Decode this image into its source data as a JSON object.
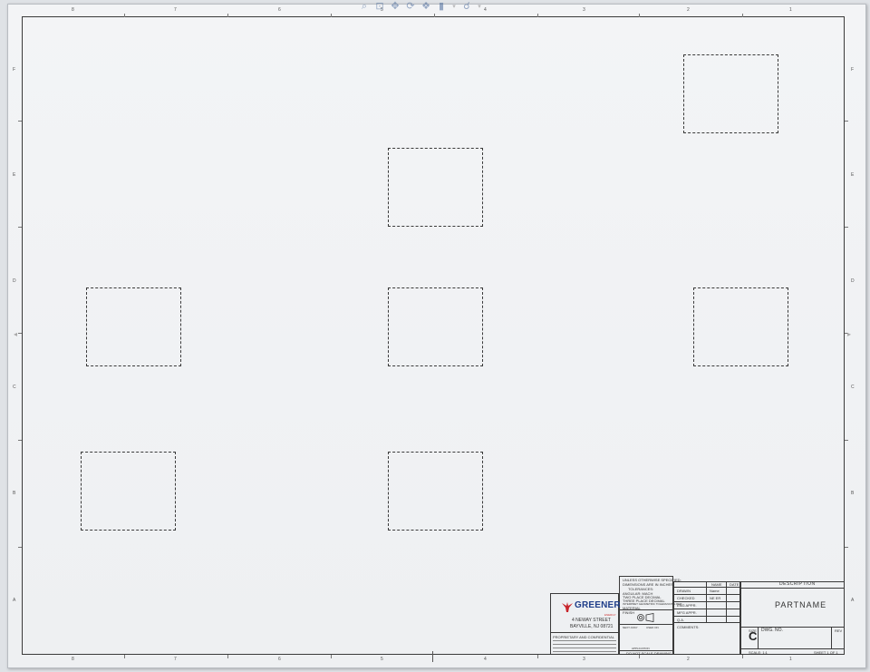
{
  "toolbar": {
    "tools": [
      {
        "name": "zoom-to-fit-icon",
        "glyph": "⌕"
      },
      {
        "name": "zoom-area-icon",
        "glyph": "⊡"
      },
      {
        "name": "pan-icon",
        "glyph": "✥"
      },
      {
        "name": "redraw-icon",
        "glyph": "⟳"
      },
      {
        "name": "view-settings-icon",
        "glyph": "❖"
      },
      {
        "name": "display-style-icon",
        "glyph": "▮"
      },
      {
        "name": "view-dropdown-arrow-icon",
        "glyph": "▾"
      },
      {
        "name": "hide-show-icon",
        "glyph": "☌"
      },
      {
        "name": "hide-show-dropdown-arrow-icon",
        "glyph": "▾"
      }
    ]
  },
  "zones": {
    "columns": [
      "8",
      "7",
      "6",
      "5",
      "4",
      "3",
      "2",
      "1"
    ],
    "rows": [
      "F",
      "E",
      "D",
      "C",
      "B",
      "A"
    ]
  },
  "title_block": {
    "company": "GREENER",
    "company_sub": "ENERGY",
    "address_line1": "4 NEWAY STREET",
    "address_line2": "BAYVILLE, NJ 08721",
    "dimensions_note": "UNLESS OTHERWISE SPECIFIED:",
    "dimensions_unit": "DIMENSIONS ARE IN INCHES",
    "tolerances": "TOLERANCES:",
    "angular": "ANGULAR: MACH",
    "two_place": "TWO PLACE DECIMAL",
    "three_place": "THREE PLACE DECIMAL",
    "interpret": "INTERPRET GEOMETRIC TOLERANCING PER:",
    "material": "MATERIAL",
    "finish": "FINISH",
    "next_assy": "NEXT ASSY",
    "used_on": "USED ON",
    "application": "APPLICATION",
    "do_not_scale": "DO NOT SCALE DRAWING",
    "proprietary": "PROPRIETARY AND CONFIDENTIAL",
    "name_header": "NAME",
    "date_header": "DATE",
    "drawn": "DRAWN",
    "drawn_name": "Name",
    "checked": "CHECKED",
    "checked_name": "NE ER",
    "eng_appr": "ENG APPR.",
    "mfg_appr": "MFG APPR.",
    "qa": "Q.A.",
    "comments": "COMMENTS:",
    "description_header": "DESCRIPTION",
    "part_name": "PARTNAME",
    "size_label": "SIZE",
    "size_value": "C",
    "dwg_no_label": "DWG.  NO.",
    "rev_label": "REV",
    "scale": "SCALE: 1:1",
    "sheet": "SHEET 1 OF 1"
  }
}
